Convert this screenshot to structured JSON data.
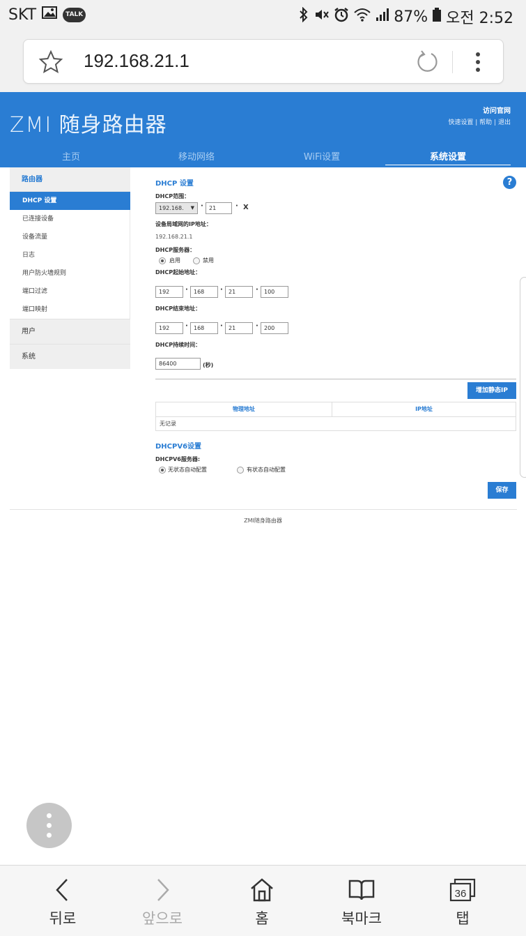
{
  "status_bar": {
    "carrier": "SKT",
    "talk_badge": "TALK",
    "battery": "87%",
    "time": "오전 2:52"
  },
  "browser": {
    "url": "192.168.21.1"
  },
  "router": {
    "logo_brand": "ZMI",
    "logo_title": "随身路由器",
    "visit_site": "访问官网",
    "quick_setup": "快速设置",
    "help": "帮助",
    "logout": "退出",
    "link_separator": "|",
    "nav": [
      {
        "label": "主页"
      },
      {
        "label": "移动网络"
      },
      {
        "label": "WiFi设置"
      },
      {
        "label": "系统设置"
      }
    ]
  },
  "sidebar": {
    "group_router": "路由器",
    "items": [
      {
        "label": "DHCP 设置"
      },
      {
        "label": "已连接设备"
      },
      {
        "label": "设备流量"
      },
      {
        "label": "日志"
      },
      {
        "label": "用户防火墙规则"
      },
      {
        "label": "端口过滤"
      },
      {
        "label": "端口映射"
      }
    ],
    "group_user": "用户",
    "group_system": "系统"
  },
  "dhcp": {
    "title": "DHCP 设置",
    "range_label": "DHCP范围：",
    "range_prefix": "192.168.",
    "range_third": "21",
    "range_suffix": "X",
    "lan_ip_label": "设备局域网的IP地址：",
    "lan_ip": "192.168.21.1",
    "server_label": "DHCP服务器：",
    "enable": "启用",
    "disable": "禁用",
    "start_label": "DHCP起始地址：",
    "start": [
      "192",
      "168",
      "21",
      "100"
    ],
    "end_label": "DHCP结束地址：",
    "end": [
      "192",
      "168",
      "21",
      "200"
    ],
    "lease_label": "DHCP持续时间：",
    "lease": "86400",
    "lease_unit": "(秒)",
    "add_static_ip": "增加静态IP",
    "table": {
      "col_mac": "物理地址",
      "col_ip": "IP地址",
      "empty": "无记录"
    }
  },
  "dhcpv6": {
    "title": "DHCPV6设置",
    "server_label": "DHCPV6服务器:",
    "stateless": "无状态自动配置",
    "stateful": "有状态自动配置",
    "save": "保存"
  },
  "footer": "ZMI随身路由器",
  "bottom_nav": {
    "back": "뒤로",
    "forward": "앞으로",
    "home": "홈",
    "bookmarks": "북마크",
    "tabs": "탭",
    "tab_count": "36"
  }
}
